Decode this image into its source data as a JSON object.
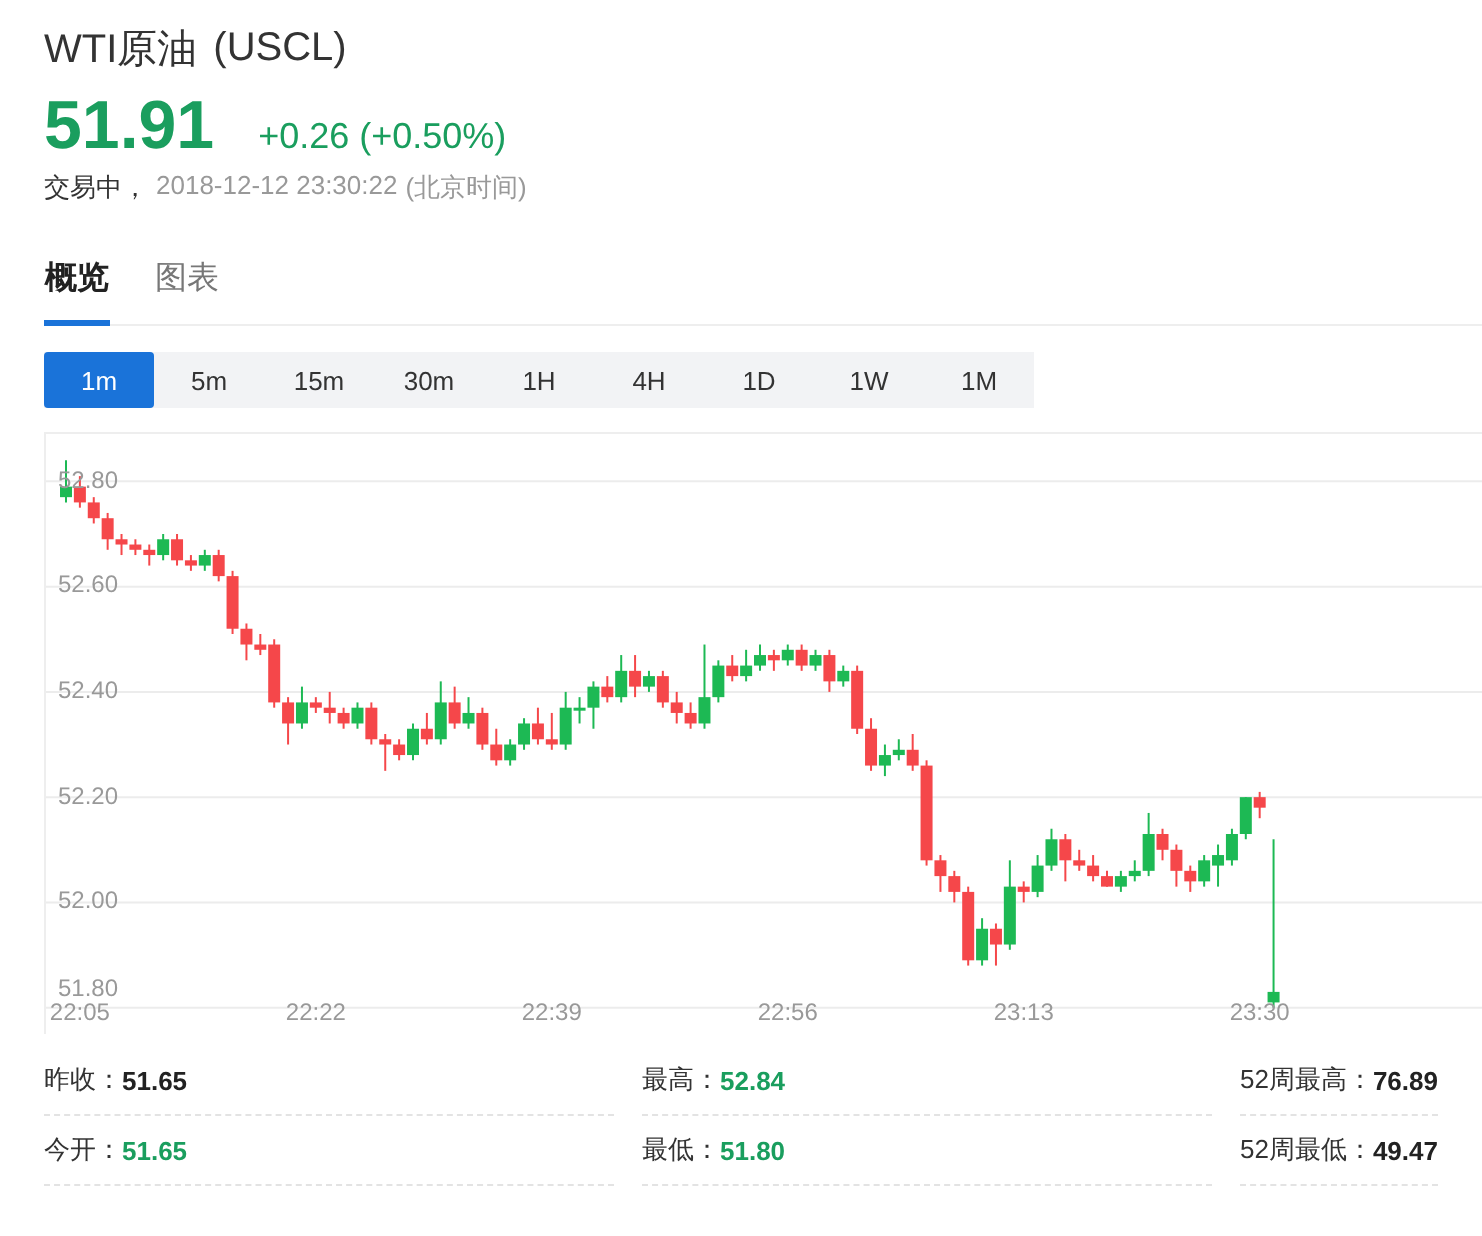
{
  "title": {
    "name": "WTI原油",
    "code": "(USCL)"
  },
  "quote": {
    "price": "51.91",
    "change": "+0.26 (+0.50%)"
  },
  "status": {
    "state": "交易中，",
    "time": "2018-12-12 23:30:22",
    "zone": "(北京时间)"
  },
  "tabs": [
    {
      "label": "概览",
      "selected": true
    },
    {
      "label": "图表",
      "selected": false
    }
  ],
  "intervals": [
    {
      "label": "1m",
      "selected": true
    },
    {
      "label": "5m",
      "selected": false
    },
    {
      "label": "15m",
      "selected": false
    },
    {
      "label": "30m",
      "selected": false
    },
    {
      "label": "1H",
      "selected": false
    },
    {
      "label": "4H",
      "selected": false
    },
    {
      "label": "1D",
      "selected": false
    },
    {
      "label": "1W",
      "selected": false
    },
    {
      "label": "1M",
      "selected": false
    }
  ],
  "chart": {
    "chart_data": {
      "type": "candlestick",
      "ylim": [
        51.75,
        52.89
      ],
      "grid": true,
      "yticks": [
        {
          "value": 52.8,
          "label": "52.80"
        },
        {
          "value": 52.6,
          "label": "52.60"
        },
        {
          "value": 52.4,
          "label": "52.40"
        },
        {
          "value": 52.2,
          "label": "52.20"
        },
        {
          "value": 52.0,
          "label": "52.00"
        },
        {
          "value": 51.8,
          "label": "51.80"
        }
      ],
      "categories": [
        null,
        "22:05",
        null,
        null,
        null,
        null,
        null,
        null,
        null,
        null,
        null,
        null,
        null,
        null,
        null,
        null,
        null,
        null,
        "22:22",
        null,
        null,
        null,
        null,
        null,
        null,
        null,
        null,
        null,
        null,
        null,
        null,
        null,
        null,
        null,
        null,
        "22:39",
        null,
        null,
        null,
        null,
        null,
        null,
        null,
        null,
        null,
        null,
        null,
        null,
        null,
        null,
        null,
        null,
        "22:56",
        null,
        null,
        null,
        null,
        null,
        null,
        null,
        null,
        null,
        null,
        null,
        null,
        null,
        null,
        null,
        null,
        "23:13",
        null,
        null,
        null,
        null,
        null,
        null,
        null,
        null,
        null,
        null,
        null,
        null,
        null,
        null,
        null,
        null,
        "23:30",
        null
      ],
      "ohlc": [
        [
          52.77,
          52.84,
          52.76,
          52.79
        ],
        [
          52.79,
          52.81,
          52.75,
          52.76
        ],
        [
          52.76,
          52.77,
          52.72,
          52.73
        ],
        [
          52.73,
          52.74,
          52.67,
          52.69
        ],
        [
          52.69,
          52.7,
          52.66,
          52.68
        ],
        [
          52.68,
          52.69,
          52.66,
          52.67
        ],
        [
          52.67,
          52.68,
          52.64,
          52.66
        ],
        [
          52.66,
          52.7,
          52.65,
          52.69
        ],
        [
          52.69,
          52.7,
          52.64,
          52.65
        ],
        [
          52.65,
          52.66,
          52.63,
          52.64
        ],
        [
          52.64,
          52.67,
          52.63,
          52.66
        ],
        [
          52.66,
          52.67,
          52.61,
          52.62
        ],
        [
          52.62,
          52.63,
          52.51,
          52.52
        ],
        [
          52.52,
          52.53,
          52.46,
          52.49
        ],
        [
          52.49,
          52.51,
          52.47,
          52.48
        ],
        [
          52.49,
          52.5,
          52.37,
          52.38
        ],
        [
          52.38,
          52.39,
          52.3,
          52.34
        ],
        [
          52.34,
          52.41,
          52.33,
          52.38
        ],
        [
          52.38,
          52.39,
          52.36,
          52.37
        ],
        [
          52.37,
          52.4,
          52.34,
          52.36
        ],
        [
          52.36,
          52.37,
          52.33,
          52.34
        ],
        [
          52.34,
          52.38,
          52.33,
          52.37
        ],
        [
          52.37,
          52.38,
          52.3,
          52.31
        ],
        [
          52.31,
          52.32,
          52.25,
          52.3
        ],
        [
          52.3,
          52.31,
          52.27,
          52.28
        ],
        [
          52.28,
          52.34,
          52.27,
          52.33
        ],
        [
          52.33,
          52.36,
          52.3,
          52.31
        ],
        [
          52.31,
          52.42,
          52.3,
          52.38
        ],
        [
          52.38,
          52.41,
          52.33,
          52.34
        ],
        [
          52.34,
          52.39,
          52.33,
          52.36
        ],
        [
          52.36,
          52.37,
          52.29,
          52.3
        ],
        [
          52.3,
          52.33,
          52.26,
          52.27
        ],
        [
          52.27,
          52.31,
          52.26,
          52.3
        ],
        [
          52.3,
          52.35,
          52.29,
          52.34
        ],
        [
          52.34,
          52.37,
          52.3,
          52.31
        ],
        [
          52.31,
          52.36,
          52.29,
          52.3
        ],
        [
          52.3,
          52.4,
          52.29,
          52.37
        ],
        [
          52.37,
          52.39,
          52.34,
          52.37
        ],
        [
          52.37,
          52.42,
          52.33,
          52.41
        ],
        [
          52.41,
          52.43,
          52.38,
          52.39
        ],
        [
          52.39,
          52.47,
          52.38,
          52.44
        ],
        [
          52.44,
          52.47,
          52.39,
          52.41
        ],
        [
          52.41,
          52.44,
          52.4,
          52.43
        ],
        [
          52.43,
          52.44,
          52.37,
          52.38
        ],
        [
          52.38,
          52.4,
          52.34,
          52.36
        ],
        [
          52.36,
          52.38,
          52.33,
          52.34
        ],
        [
          52.34,
          52.49,
          52.33,
          52.39
        ],
        [
          52.39,
          52.46,
          52.38,
          52.45
        ],
        [
          52.45,
          52.47,
          52.42,
          52.43
        ],
        [
          52.43,
          52.48,
          52.42,
          52.45
        ],
        [
          52.45,
          52.49,
          52.44,
          52.47
        ],
        [
          52.47,
          52.48,
          52.44,
          52.46
        ],
        [
          52.46,
          52.49,
          52.45,
          52.48
        ],
        [
          52.48,
          52.49,
          52.44,
          52.45
        ],
        [
          52.45,
          52.48,
          52.44,
          52.47
        ],
        [
          52.47,
          52.48,
          52.4,
          52.42
        ],
        [
          52.42,
          52.45,
          52.41,
          52.44
        ],
        [
          52.44,
          52.45,
          52.32,
          52.33
        ],
        [
          52.33,
          52.35,
          52.25,
          52.26
        ],
        [
          52.26,
          52.3,
          52.24,
          52.28
        ],
        [
          52.28,
          52.31,
          52.27,
          52.29
        ],
        [
          52.29,
          52.32,
          52.25,
          52.26
        ],
        [
          52.26,
          52.27,
          52.07,
          52.08
        ],
        [
          52.08,
          52.09,
          52.02,
          52.05
        ],
        [
          52.05,
          52.06,
          52.0,
          52.02
        ],
        [
          52.02,
          52.03,
          51.88,
          51.89
        ],
        [
          51.89,
          51.97,
          51.88,
          51.95
        ],
        [
          51.95,
          51.96,
          51.88,
          51.92
        ],
        [
          51.92,
          52.08,
          51.91,
          52.03
        ],
        [
          52.03,
          52.04,
          52.0,
          52.02
        ],
        [
          52.02,
          52.09,
          52.01,
          52.07
        ],
        [
          52.07,
          52.14,
          52.06,
          52.12
        ],
        [
          52.12,
          52.13,
          52.04,
          52.08
        ],
        [
          52.08,
          52.1,
          52.06,
          52.07
        ],
        [
          52.07,
          52.09,
          52.04,
          52.05
        ],
        [
          52.05,
          52.06,
          52.03,
          52.03
        ],
        [
          52.03,
          52.06,
          52.02,
          52.05
        ],
        [
          52.05,
          52.08,
          52.04,
          52.06
        ],
        [
          52.06,
          52.17,
          52.05,
          52.13
        ],
        [
          52.13,
          52.14,
          52.08,
          52.1
        ],
        [
          52.1,
          52.11,
          52.03,
          52.06
        ],
        [
          52.06,
          52.07,
          52.02,
          52.04
        ],
        [
          52.04,
          52.09,
          52.03,
          52.08
        ],
        [
          52.07,
          52.11,
          52.03,
          52.09
        ],
        [
          52.08,
          52.14,
          52.07,
          52.13
        ],
        [
          52.13,
          52.2,
          52.12,
          52.2
        ],
        [
          52.2,
          52.21,
          52.16,
          52.18
        ],
        [
          51.81,
          52.12,
          51.8,
          51.83
        ]
      ]
    }
  },
  "stats": [
    {
      "label": "昨收：",
      "value": "51.65",
      "color": "#222222"
    },
    {
      "label": "最高：",
      "value": "52.84",
      "color": "#1a9e5e"
    },
    {
      "label": "52周最高：",
      "value": "76.89",
      "color": "#222222"
    },
    {
      "label": "今开：",
      "value": "51.65",
      "color": "#1a9e5e"
    },
    {
      "label": "最低：",
      "value": "51.80",
      "color": "#1a9e5e"
    },
    {
      "label": "52周最低：",
      "value": "49.47",
      "color": "#222222"
    }
  ]
}
